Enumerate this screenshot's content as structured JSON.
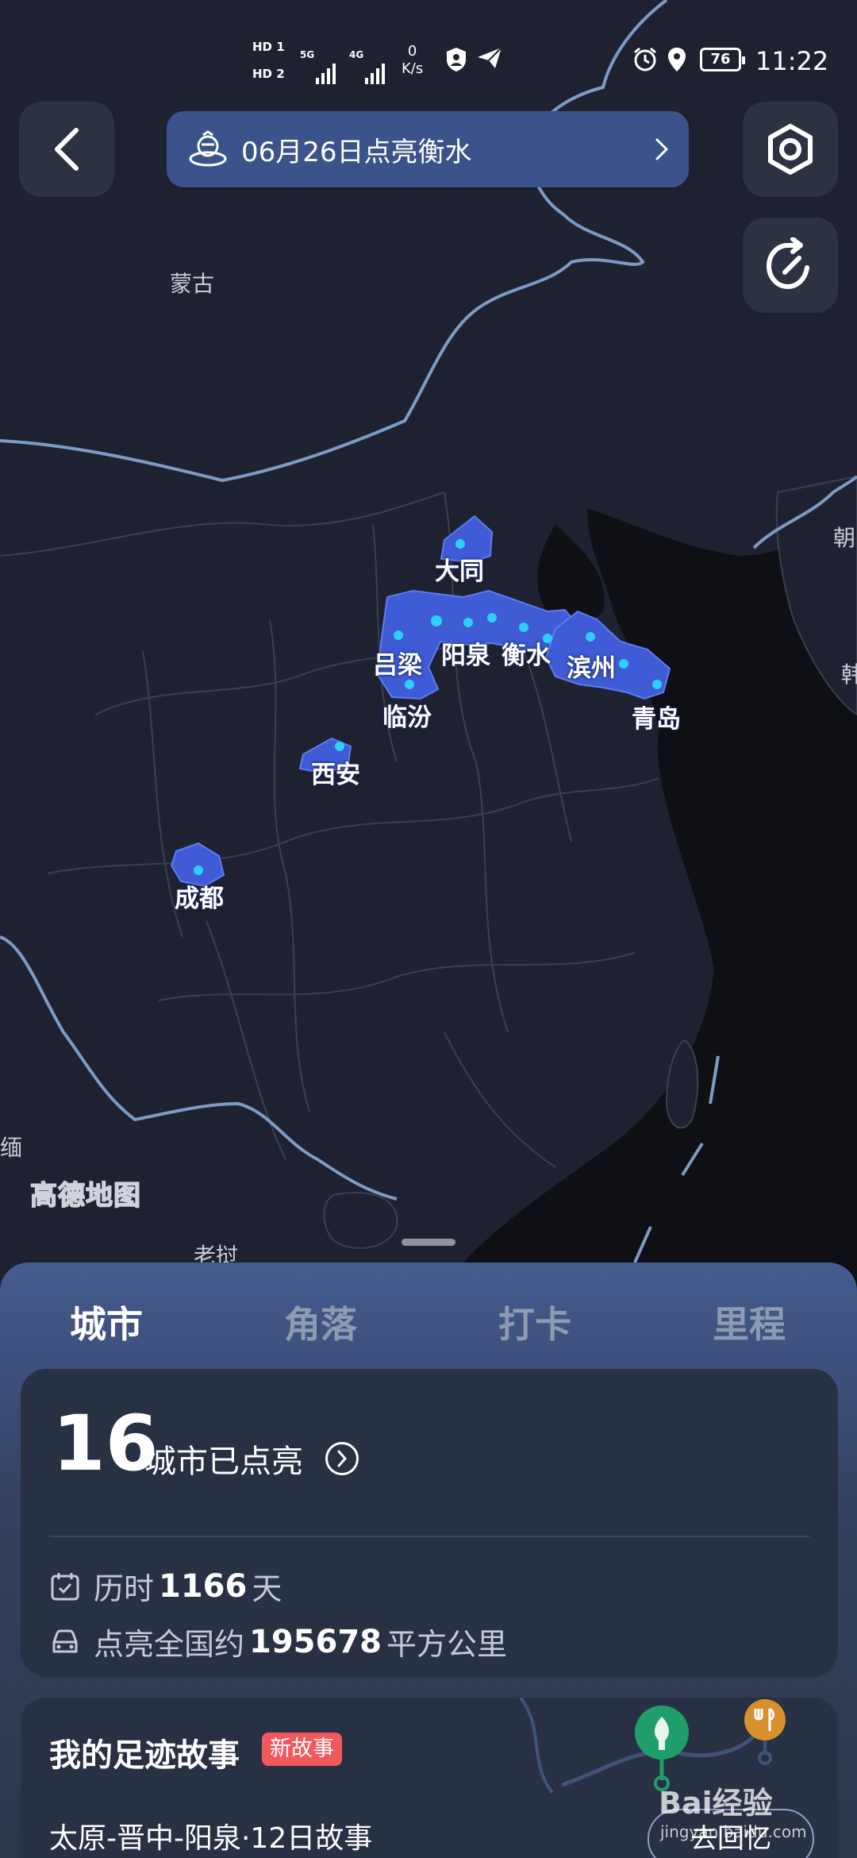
{
  "status_bar": {
    "hd1": "HD 1",
    "hd2": "HD 2",
    "net1": "5G",
    "net2": "4G",
    "speed_value": "0",
    "speed_unit": "K/s",
    "battery": "76",
    "time": "11:22"
  },
  "header": {
    "back_icon": "chevron-left-icon",
    "banner_text": "06月26日点亮衡水",
    "banner_icon": "astronaut-icon",
    "settings_icon": "hexagon-nut-icon",
    "share_icon": "share-icon"
  },
  "map": {
    "logo_text": "高德地图",
    "country_labels": [
      "蒙古",
      "朝",
      "韩",
      "老挝",
      "缅"
    ],
    "lit_color": "#3f5bd6",
    "cities": [
      "大同",
      "吕梁",
      "阳泉",
      "衡水",
      "滨州",
      "临汾",
      "青岛",
      "西安",
      "成都"
    ]
  },
  "panel": {
    "tabs": [
      "城市",
      "角落",
      "打卡",
      "里程"
    ],
    "active_tab": "城市",
    "stats": {
      "city_count": "16",
      "city_label": "城市已点亮",
      "duration_prefix": "历时",
      "duration_value": "1166",
      "duration_unit": "天",
      "area_prefix": "点亮全国约",
      "area_value": "195678",
      "area_unit": "平方公里"
    },
    "story": {
      "title": "我的足迹故事",
      "badge": "新故事",
      "subtitle": "太原-晋中-阳泉·12日故事",
      "button": "去回忆"
    }
  },
  "watermark": {
    "brand": "Bai经验",
    "url": "jingyan.baidu.com"
  }
}
